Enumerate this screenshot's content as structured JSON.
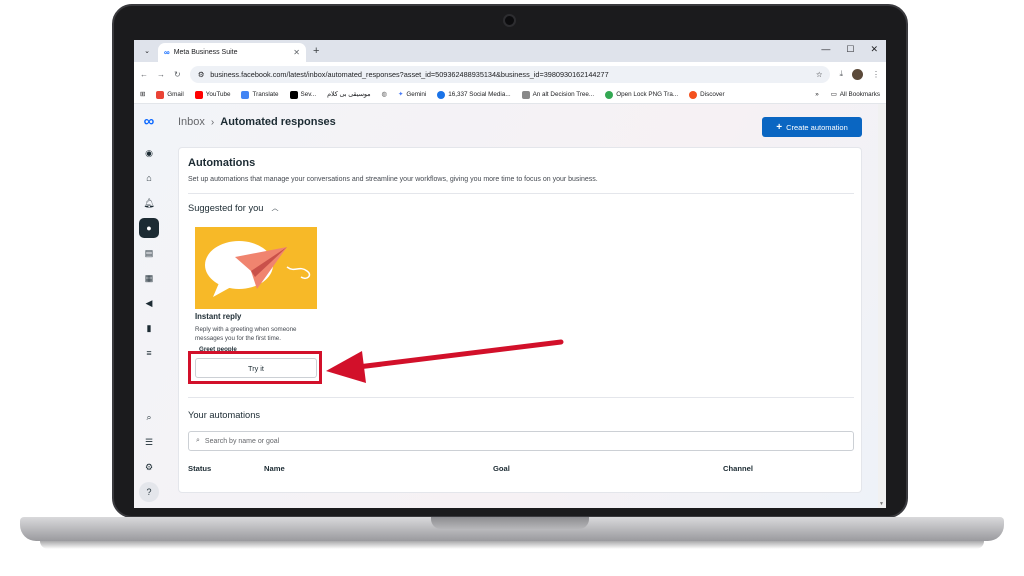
{
  "browser": {
    "tab_title": "Meta Business Suite",
    "url": "business.facebook.com/latest/inbox/automated_responses?asset_id=509362488935134&business_id=3980930162144277",
    "bookmarks": [
      {
        "label": "Gmail",
        "color": "#ea4335"
      },
      {
        "label": "YouTube",
        "color": "#ff0000"
      },
      {
        "label": "Translate",
        "color": "#4285f4"
      },
      {
        "label": "Sev...",
        "color": "#000000"
      },
      {
        "label": "موسيقى بى كلام",
        "color": "#ffffff"
      },
      {
        "label": "Gemini",
        "color": "#4a7cf6"
      },
      {
        "label": "16,337 Social Media...",
        "color": "#1a73e8"
      },
      {
        "label": "An alt Decision Tree...",
        "color": "#888888"
      },
      {
        "label": "Open Lock PNG Tra...",
        "color": "#34a853"
      },
      {
        "label": "Discover",
        "color": "#f4511e"
      }
    ],
    "all_bookmarks": "All Bookmarks"
  },
  "header": {
    "breadcrumb_parent": "Inbox",
    "breadcrumb_current": "Automated responses",
    "create_button": "Create automation"
  },
  "automations": {
    "title": "Automations",
    "description": "Set up automations that manage your conversations and streamline your workflows, giving you more time to focus on your business.",
    "suggested_heading": "Suggested for you",
    "tile": {
      "title": "Instant reply",
      "description": "Reply with a greeting when someone messages you for the first time.",
      "extra": "Greet people",
      "button": "Try it"
    },
    "your_heading": "Your automations",
    "search_placeholder": "Search by name or goal",
    "columns": [
      "Status",
      "Name",
      "Goal",
      "Channel"
    ]
  },
  "colors": {
    "primary": "#0a66c2",
    "highlight": "#d2102a",
    "tile_bg": "#f7b928"
  }
}
